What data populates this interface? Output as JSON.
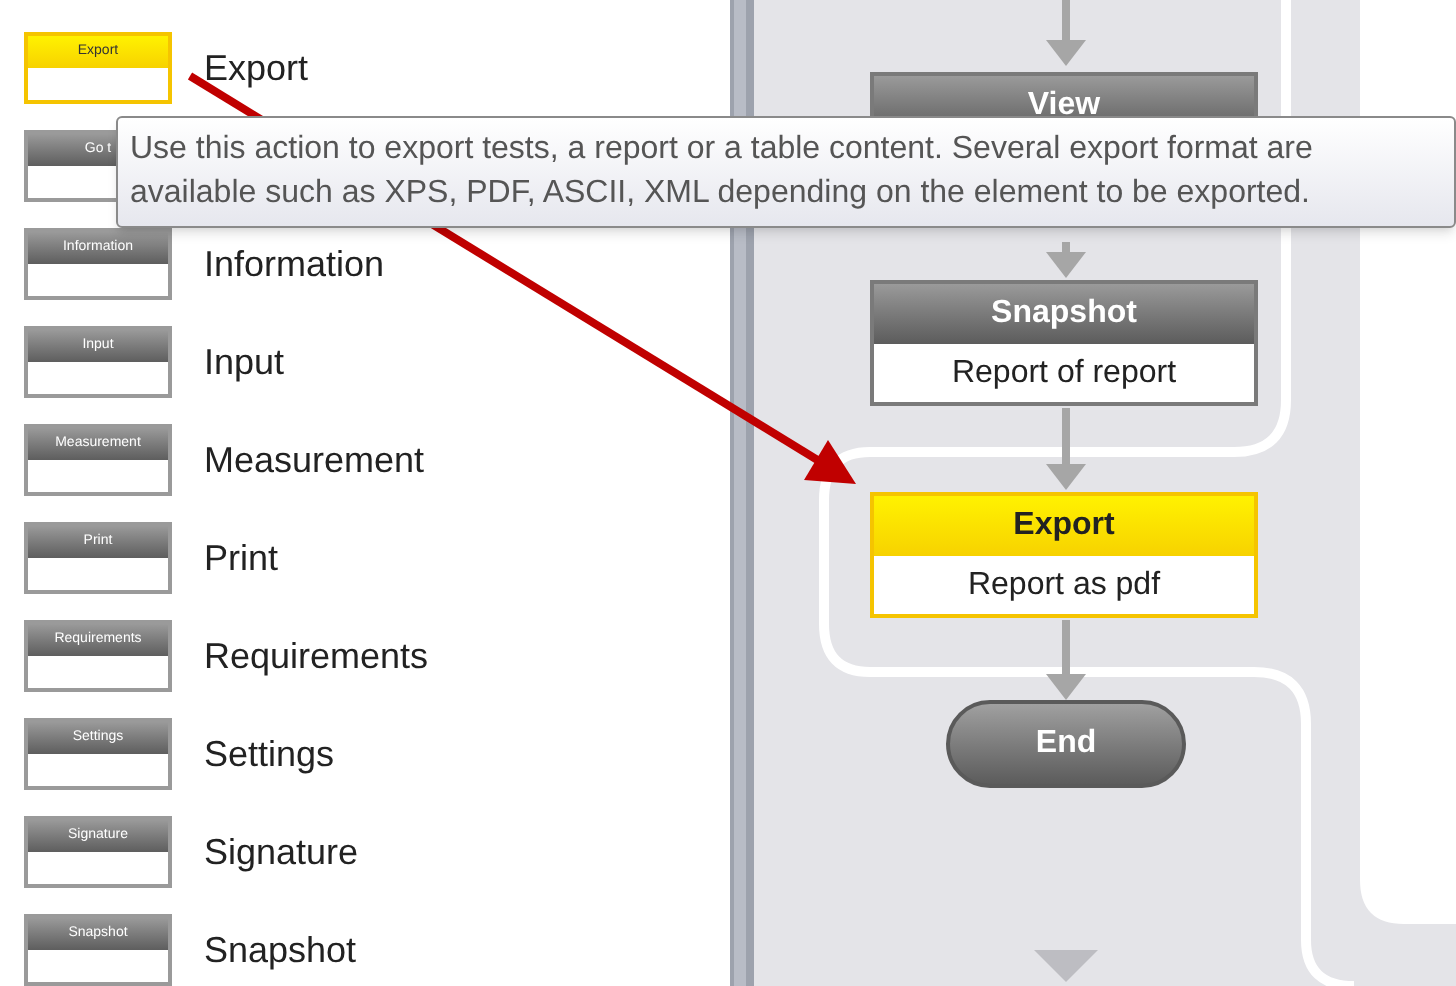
{
  "palette": [
    {
      "icon_label": "Export",
      "label": "Export",
      "selected": true
    },
    {
      "icon_label": "Go t",
      "selected": false
    },
    {
      "icon_label": "Information",
      "label": "Information",
      "selected": false
    },
    {
      "icon_label": "Input",
      "label": "Input",
      "selected": false
    },
    {
      "icon_label": "Measurement",
      "label": "Measurement",
      "selected": false
    },
    {
      "icon_label": "Print",
      "label": "Print",
      "selected": false
    },
    {
      "icon_label": "Requirements",
      "label": "Requirements",
      "selected": false
    },
    {
      "icon_label": "Settings",
      "label": "Settings",
      "selected": false
    },
    {
      "icon_label": "Signature",
      "label": "Signature",
      "selected": false
    },
    {
      "icon_label": "Snapshot",
      "label": "Snapshot",
      "selected": false
    }
  ],
  "tooltip": "Use this action to export tests, a report or a table content. Several export format are available such as XPS, PDF, ASCII, XML depending on the element to be exported.",
  "flow": [
    {
      "kind": "action",
      "title": "View",
      "selected": false
    },
    {
      "kind": "action",
      "title": "Snapshot",
      "text": "Report of report",
      "selected": false
    },
    {
      "kind": "action",
      "title": "Export",
      "text": "Report as pdf",
      "selected": true
    },
    {
      "kind": "terminal",
      "title": "End",
      "selected": false
    }
  ]
}
